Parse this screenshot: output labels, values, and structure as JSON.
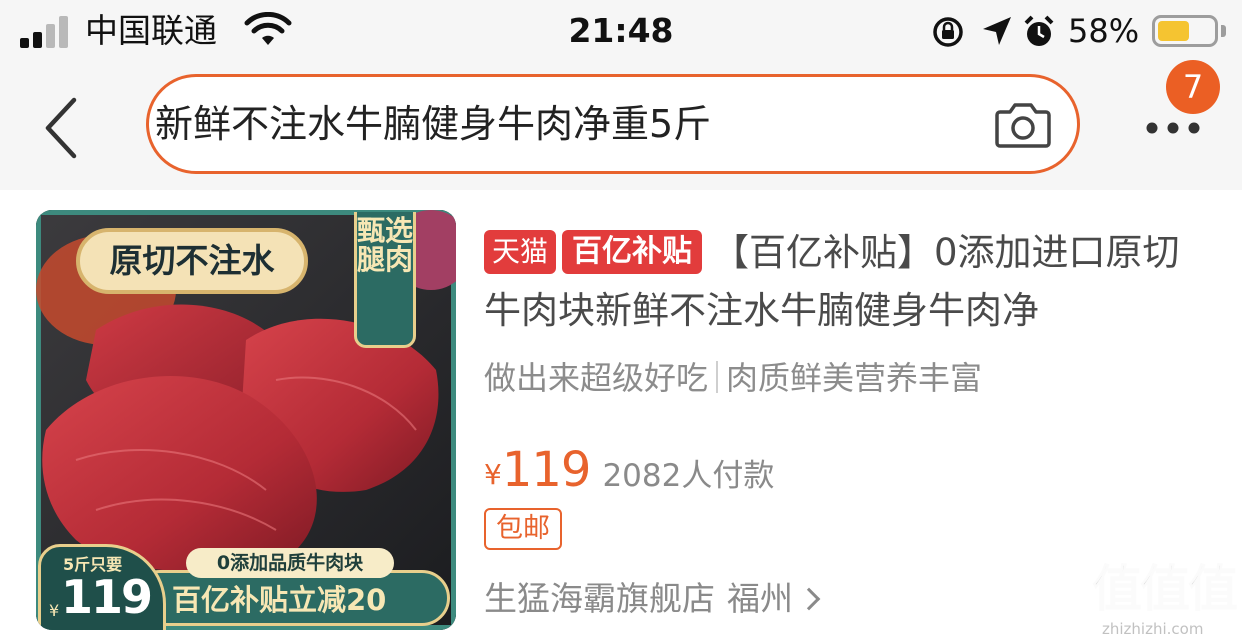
{
  "status_bar": {
    "carrier": "中国联通",
    "time": "21:48",
    "battery_percent": "58%",
    "battery_level": 0.58,
    "icons": [
      "signal-icon",
      "wifi-icon",
      "orientation-lock-icon",
      "location-arrow-icon",
      "alarm-icon",
      "battery-icon"
    ]
  },
  "header": {
    "back_icon": "chevron-left-icon",
    "search_query": "新鲜不注水牛腩健身牛肉净重5斤",
    "camera_icon": "camera-icon",
    "more_icon": "more-dots-icon",
    "notification_count": "7",
    "accent_color": "#e8632d"
  },
  "product": {
    "image": {
      "tag_text": "原切不注水",
      "vertical_text": "甄选腿肉",
      "bottom_sub": "0添加品质牛肉块",
      "bottom_main": "百亿补贴立减20",
      "price_prefix": "5斤只要",
      "currency": "¥",
      "price": "119"
    },
    "tag_tmall": "天猫",
    "tag_subsidy": "百亿补贴",
    "title": "【百亿补贴】0添加进口原切牛肉块新鲜不注水牛腩健身牛肉净",
    "subtitle_left": "做出来超级好吃",
    "subtitle_right": "肉质鲜美营养丰富",
    "currency": "¥",
    "price": "119",
    "sales": "2082人付款",
    "free_shipping": "包邮",
    "shop_name": "生猛海霸旗舰店",
    "shop_location": "福州",
    "price_color": "#e8632d",
    "tag_color": "#e23c3c"
  },
  "watermark": {
    "main": "值值值",
    "url": "zhizhizhi.com"
  }
}
